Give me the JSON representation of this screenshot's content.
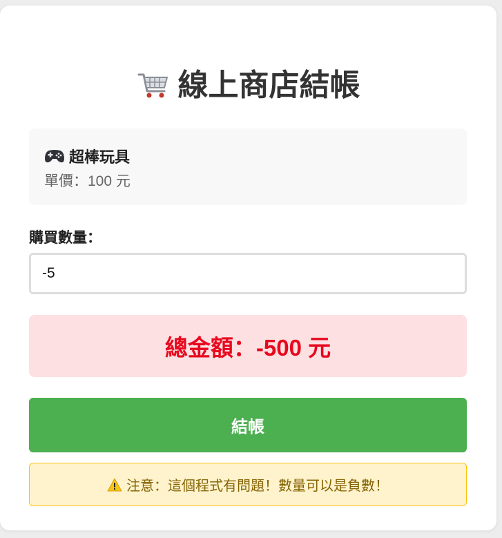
{
  "page": {
    "title": "線上商店結帳",
    "title_icon": "shopping-cart-icon"
  },
  "product": {
    "icon": "gamepad-icon",
    "name": "超棒玩具",
    "price_text": "單價：100 元"
  },
  "quantity": {
    "label": "購買數量：",
    "value": "-5"
  },
  "total": {
    "text": "總金額：-500 元"
  },
  "checkout": {
    "label": "結帳"
  },
  "warning": {
    "icon": "warning-icon",
    "text": "注意：這個程式有問題！數量可以是負數！"
  },
  "colors": {
    "accent_green": "#4caf50",
    "total_red": "#e8081e",
    "total_bg": "#fde0e2",
    "warning_bg": "#fff3cd",
    "warning_border": "#ffc107"
  }
}
